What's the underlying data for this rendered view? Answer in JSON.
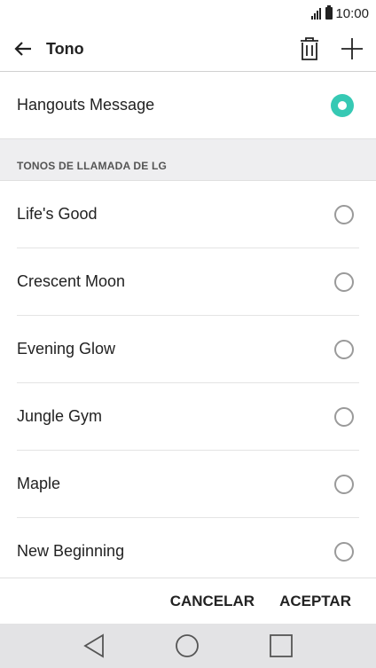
{
  "status": {
    "time": "10:00"
  },
  "header": {
    "title": "Tono",
    "icons": [
      "back-arrow-icon",
      "trash-icon",
      "plus-icon"
    ]
  },
  "selected_item": {
    "label": "Hangouts Message",
    "selected": true
  },
  "section": {
    "title": "TONOS DE LLAMADA DE LG"
  },
  "ringtones": [
    {
      "label": "Life's Good"
    },
    {
      "label": "Crescent Moon"
    },
    {
      "label": "Evening Glow"
    },
    {
      "label": "Jungle Gym"
    },
    {
      "label": "Maple"
    },
    {
      "label": "New Beginning"
    }
  ],
  "buttons": {
    "cancel": "CANCELAR",
    "accept": "ACEPTAR"
  },
  "colors": {
    "accent": "#36c9b4",
    "section_bg": "#eeeef0",
    "nav_bg": "#e3e3e5"
  }
}
